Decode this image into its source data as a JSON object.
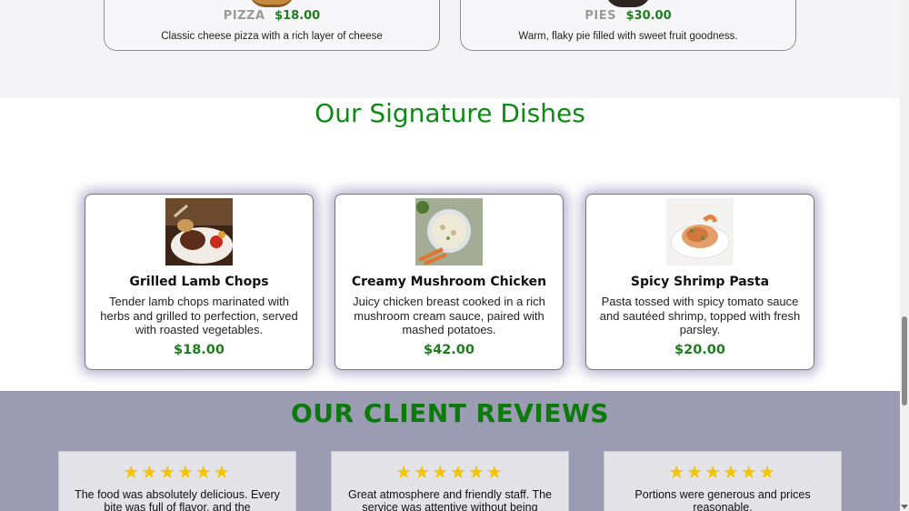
{
  "categories": [
    {
      "name": "PIZZA",
      "price": "$18.00",
      "description": "Classic cheese pizza with a rich layer of cheese",
      "icon": "pizza-image"
    },
    {
      "name": "PIES",
      "price": "$30.00",
      "description": "Warm, flaky pie filled with sweet fruit goodness.",
      "icon": "pie-image"
    }
  ],
  "signature": {
    "title": "Our Signature Dishes",
    "dishes": [
      {
        "name": "Grilled Lamb Chops",
        "description": "Tender lamb chops marinated with herbs and grilled to perfection, served with roasted vegetables.",
        "price": "$18.00"
      },
      {
        "name": "Creamy Mushroom Chicken",
        "description": "Juicy chicken breast cooked in a rich mushroom cream sauce, paired with mashed potatoes.",
        "price": "$42.00"
      },
      {
        "name": "Spicy Shrimp Pasta",
        "description": "Pasta tossed with spicy tomato sauce and sautéed shrimp, topped with fresh parsley.",
        "price": "$20.00"
      }
    ]
  },
  "reviews": {
    "title": "OUR CLIENT REVIEWS",
    "stars": "★★★★★★",
    "items": [
      {
        "text": "The food was absolutely delicious. Every bite was full of flavor, and the"
      },
      {
        "text": "Great atmosphere and friendly staff. The service was attentive without being"
      },
      {
        "text": "Portions were generous and prices reasonable."
      }
    ]
  },
  "colors": {
    "accent_green": "#0f8a16",
    "price_green": "#1e7d1e",
    "star": "#f5c400",
    "reviews_bg": "#9b9bb3"
  }
}
